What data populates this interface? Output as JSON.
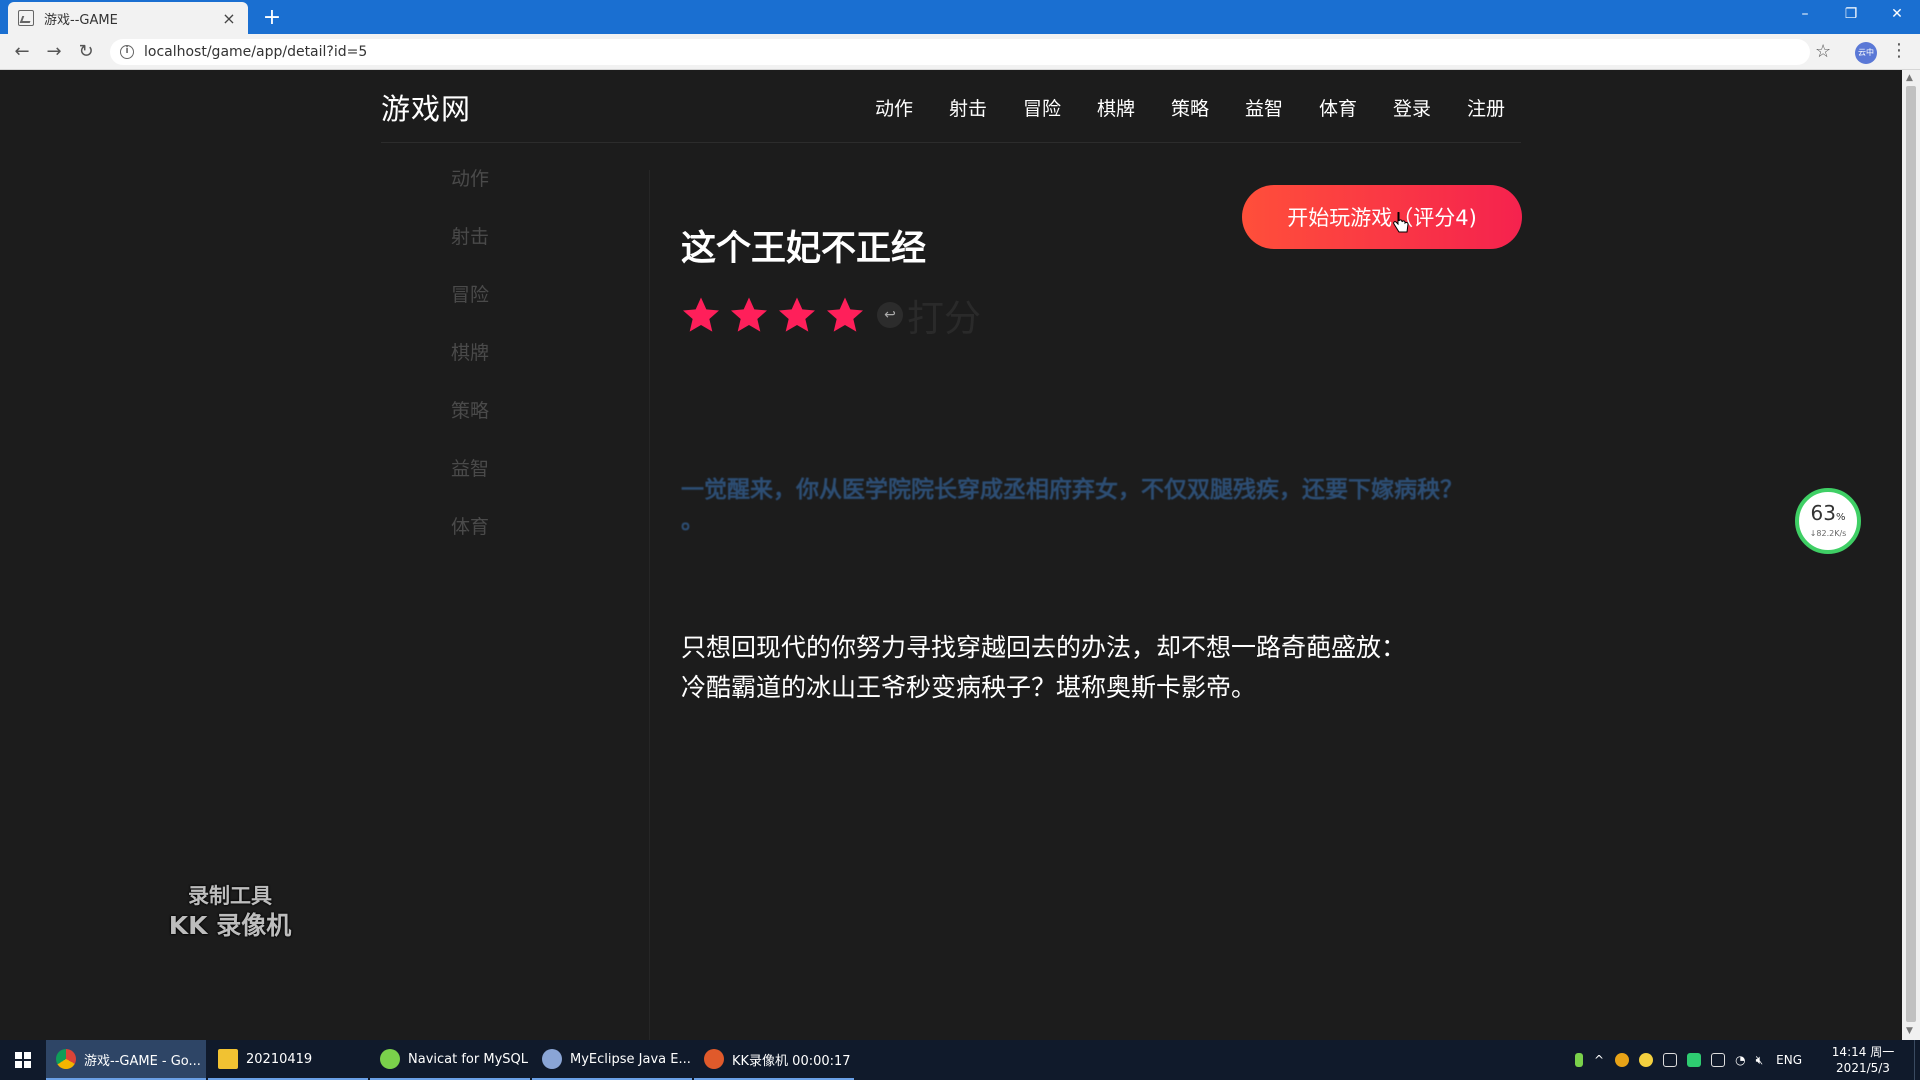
{
  "browser": {
    "tab_title": "游戏--GAME",
    "tab_close": "×",
    "new_tab": "+",
    "url": "localhost/game/app/detail?id=5",
    "window_controls": {
      "minimize": "–",
      "restore": "❐",
      "close": "✕"
    },
    "nav": {
      "back": "←",
      "forward": "→",
      "reload": "↻",
      "bookmark": "☆",
      "menu": "⋮"
    },
    "profile_label": "云中"
  },
  "site": {
    "logo": "游戏网",
    "nav": [
      {
        "label": "动作"
      },
      {
        "label": "射击"
      },
      {
        "label": "冒险"
      },
      {
        "label": "棋牌"
      },
      {
        "label": "策略"
      },
      {
        "label": "益智"
      },
      {
        "label": "体育"
      },
      {
        "label": "登录"
      },
      {
        "label": "注册"
      }
    ]
  },
  "sidebar": {
    "items": [
      {
        "label": "动作"
      },
      {
        "label": "射击"
      },
      {
        "label": "冒险"
      },
      {
        "label": "棋牌"
      },
      {
        "label": "策略"
      },
      {
        "label": "益智"
      },
      {
        "label": "体育"
      }
    ]
  },
  "game": {
    "title": "这个王妃不正经",
    "rating": {
      "filled": 4,
      "max": 5,
      "back_glyph": "↩",
      "label": "打分",
      "star_color": "#ff1f5a"
    },
    "blurb": "一觉醒来，你从医学院院长穿成丞相府弃女，不仅双腿残疾，还要下嫁病秧？ 。",
    "description": [
      "只想回现代的你努力寻找穿越回去的办法，却不想一路奇葩盛放：",
      "冷酷霸道的冰山王爷秒变病秧子？堪称奥斯卡影帝。"
    ],
    "play_button": "开始玩游戏（评分4)"
  },
  "watermark": {
    "line1": "录制工具",
    "line2": "KK 录像机"
  },
  "speed_gauge": {
    "percent": "63",
    "unit": "%",
    "rate": "↓82.2K/s",
    "ring_color": "#3fcf65"
  },
  "taskbar": {
    "tasks": [
      {
        "label": "游戏--GAME - Go...",
        "color": "#e8b417"
      },
      {
        "label": "20210419",
        "color": "#f1c232"
      },
      {
        "label": "Navicat for MySQL",
        "color": "#7ad14b"
      },
      {
        "label": "MyEclipse Java E...",
        "color": "#8aa5d6"
      },
      {
        "label": "KK录像机 00:00:17",
        "color": "#e05a2b"
      }
    ],
    "tray_lang": "ENG",
    "clock_time": "14:14 周一",
    "clock_date": "2021/5/3"
  }
}
